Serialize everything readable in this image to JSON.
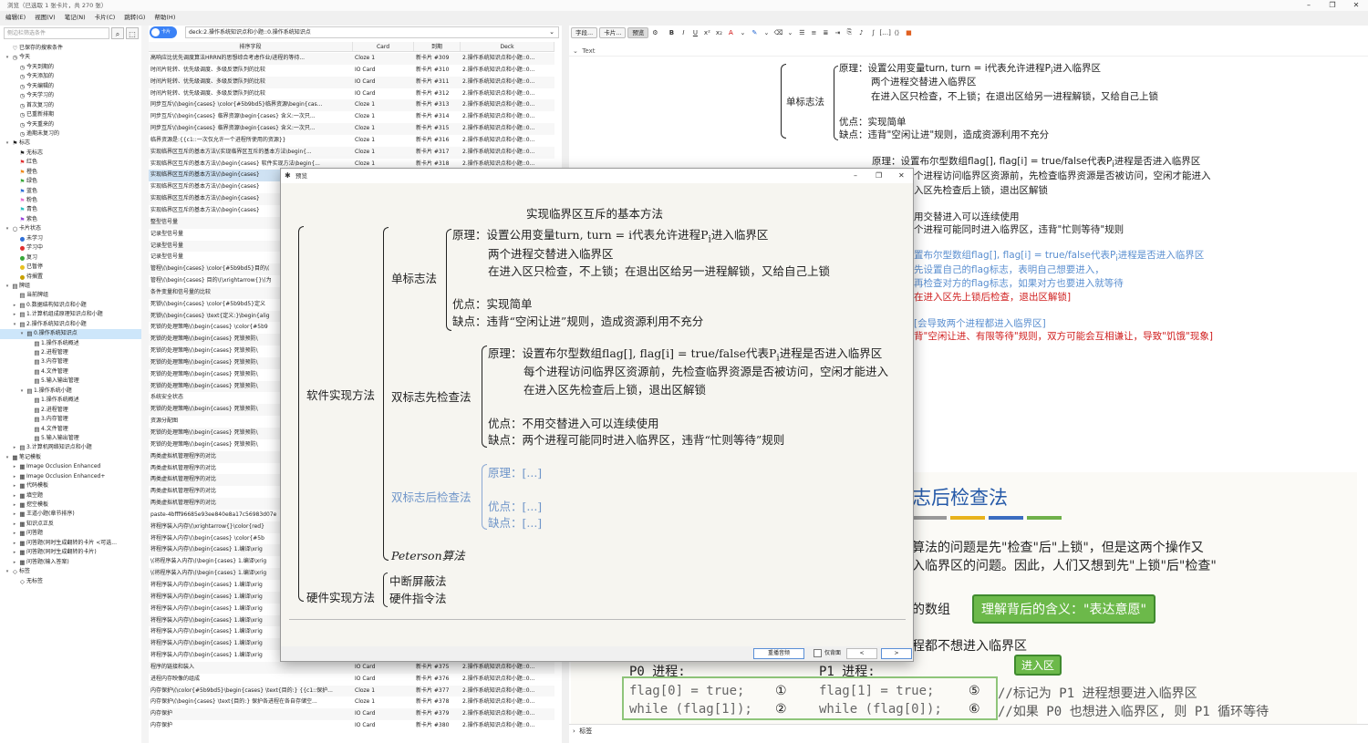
{
  "window": {
    "title": "浏览（已选取 1 张卡片，共 270 张）",
    "controls": [
      "–",
      "❐",
      "✕"
    ]
  },
  "menu": [
    "编辑(E)",
    "视图(V)",
    "笔记(N)",
    "卡片(C)",
    "跳转(G)",
    "帮助(H)"
  ],
  "sidebar": {
    "search_placeholder": "侧边栏筛选条件",
    "tree": [
      {
        "d": 0,
        "ex": "",
        "ic": "♡",
        "label": "已保存的搜索条件"
      },
      {
        "d": 0,
        "ex": "▾",
        "ic": "◷",
        "label": "今天"
      },
      {
        "d": 1,
        "ex": "",
        "ic": "◷",
        "label": "今天到期的"
      },
      {
        "d": 1,
        "ex": "",
        "ic": "◷",
        "label": "今天添加的"
      },
      {
        "d": 1,
        "ex": "",
        "ic": "◷",
        "label": "今天编辑的"
      },
      {
        "d": 1,
        "ex": "",
        "ic": "◷",
        "label": "今天学习的"
      },
      {
        "d": 1,
        "ex": "",
        "ic": "◷",
        "label": "首次复习的"
      },
      {
        "d": 1,
        "ex": "",
        "ic": "◷",
        "label": "已重新排期"
      },
      {
        "d": 1,
        "ex": "",
        "ic": "◷",
        "label": "今天重来的"
      },
      {
        "d": 1,
        "ex": "",
        "ic": "◷",
        "label": "逾期未复习的"
      },
      {
        "d": 0,
        "ex": "▾",
        "ic": "⚑",
        "label": "标志"
      },
      {
        "d": 1,
        "ex": "",
        "ic": "⚑",
        "label": "无标志"
      },
      {
        "d": 1,
        "ex": "",
        "ic": "⚑",
        "label": "红色",
        "color": "#e03030"
      },
      {
        "d": 1,
        "ex": "",
        "ic": "⚑",
        "label": "橙色",
        "color": "#f08a1c"
      },
      {
        "d": 1,
        "ex": "",
        "ic": "⚑",
        "label": "绿色",
        "color": "#38a838"
      },
      {
        "d": 1,
        "ex": "",
        "ic": "⚑",
        "label": "蓝色",
        "color": "#2f6fd8"
      },
      {
        "d": 1,
        "ex": "",
        "ic": "⚑",
        "label": "粉色",
        "color": "#e86fcf"
      },
      {
        "d": 1,
        "ex": "",
        "ic": "⚑",
        "label": "青色",
        "color": "#2ac3c3"
      },
      {
        "d": 1,
        "ex": "",
        "ic": "⚑",
        "label": "紫色",
        "color": "#9944dd"
      },
      {
        "d": 0,
        "ex": "▾",
        "ic": "○",
        "label": "卡片状态"
      },
      {
        "d": 1,
        "ex": "",
        "ic": "●",
        "label": "未学习",
        "color": "#2f6fd8"
      },
      {
        "d": 1,
        "ex": "",
        "ic": "●",
        "label": "学习中",
        "color": "#e03030"
      },
      {
        "d": 1,
        "ex": "",
        "ic": "●",
        "label": "复习",
        "color": "#38a838"
      },
      {
        "d": 1,
        "ex": "",
        "ic": "●",
        "label": "已暂停",
        "color": "#e8c020"
      },
      {
        "d": 1,
        "ex": "",
        "ic": "●",
        "label": "待搁置",
        "color": "#c8a000"
      },
      {
        "d": 0,
        "ex": "▾",
        "ic": "▤",
        "label": "牌组"
      },
      {
        "d": 1,
        "ex": "",
        "ic": "▤",
        "label": "当前牌组"
      },
      {
        "d": 1,
        "ex": "▸",
        "ic": "▤",
        "label": "0.数据结构知识点和小题"
      },
      {
        "d": 1,
        "ex": "▸",
        "ic": "▤",
        "label": "1.计算机组成原理知识点和小题"
      },
      {
        "d": 1,
        "ex": "▾",
        "ic": "▤",
        "label": "2.操作系统知识点和小题"
      },
      {
        "d": 2,
        "ex": "▾",
        "ic": "▤",
        "label": "0.操作系统知识点",
        "sel": true
      },
      {
        "d": 3,
        "ex": "",
        "ic": "▤",
        "label": "1.操作系统概述"
      },
      {
        "d": 3,
        "ex": "",
        "ic": "▤",
        "label": "2.进程管理"
      },
      {
        "d": 3,
        "ex": "",
        "ic": "▤",
        "label": "3.内存管理"
      },
      {
        "d": 3,
        "ex": "",
        "ic": "▤",
        "label": "4.文件管理"
      },
      {
        "d": 3,
        "ex": "",
        "ic": "▤",
        "label": "5.输入输出管理"
      },
      {
        "d": 2,
        "ex": "▾",
        "ic": "▤",
        "label": "1.操作系统小题"
      },
      {
        "d": 3,
        "ex": "",
        "ic": "▤",
        "label": "1.操作系统概述"
      },
      {
        "d": 3,
        "ex": "",
        "ic": "▤",
        "label": "2.进程管理"
      },
      {
        "d": 3,
        "ex": "",
        "ic": "▤",
        "label": "3.内存管理"
      },
      {
        "d": 3,
        "ex": "",
        "ic": "▤",
        "label": "4.文件管理"
      },
      {
        "d": 3,
        "ex": "",
        "ic": "▤",
        "label": "5.输入输出管理"
      },
      {
        "d": 1,
        "ex": "▸",
        "ic": "▤",
        "label": "3.计算机网络知识点和小题"
      },
      {
        "d": 0,
        "ex": "▾",
        "ic": "▦",
        "label": "笔记模板"
      },
      {
        "d": 1,
        "ex": "▸",
        "ic": "▦",
        "label": "Image Occlusion Enhanced"
      },
      {
        "d": 1,
        "ex": "▸",
        "ic": "▦",
        "label": "Image Occlusion Enhanced+"
      },
      {
        "d": 1,
        "ex": "▸",
        "ic": "▦",
        "label": "代码模板"
      },
      {
        "d": 1,
        "ex": "▸",
        "ic": "▦",
        "label": "填空题"
      },
      {
        "d": 1,
        "ex": "▸",
        "ic": "▦",
        "label": "挖空模板"
      },
      {
        "d": 1,
        "ex": "▸",
        "ic": "▦",
        "label": "王道小题(章节排序)"
      },
      {
        "d": 1,
        "ex": "▸",
        "ic": "▦",
        "label": "知识点正反"
      },
      {
        "d": 1,
        "ex": "▸",
        "ic": "▦",
        "label": "问答题"
      },
      {
        "d": 1,
        "ex": "▸",
        "ic": "▦",
        "label": "问答题(同时生成翻转的卡片 <可选..."
      },
      {
        "d": 1,
        "ex": "▸",
        "ic": "▦",
        "label": "问答题(同时生成翻转的卡片)"
      },
      {
        "d": 1,
        "ex": "▸",
        "ic": "▦",
        "label": "问答题(输入答案)"
      },
      {
        "d": 0,
        "ex": "▾",
        "ic": "◇",
        "label": "标签"
      },
      {
        "d": 1,
        "ex": "",
        "ic": "◇",
        "label": "无标签"
      }
    ]
  },
  "browser": {
    "toggle_label": "卡片",
    "query": "deck:2.操作系统知识点和小题::0.操作系统知识点",
    "columns": [
      "排序字段",
      "Card",
      "到期",
      "Deck"
    ],
    "rows": [
      [
        "高响应比优先调度算法HRRN的思想综合考虑作业/进程的等待...",
        "Cloze 1",
        "新卡片 #309",
        "2.操作系统知识点和小题::0..."
      ],
      [
        "时间片轮转、优先级调度、多级反馈队列的比较",
        "IO Card",
        "新卡片 #310",
        "2.操作系统知识点和小题::0..."
      ],
      [
        "时间片轮转、优先级调度、多级反馈队列的比较",
        "IO Card",
        "新卡片 #311",
        "2.操作系统知识点和小题::0..."
      ],
      [
        "时间片轮转、优先级调度、多级反馈队列的比较",
        "IO Card",
        "新卡片 #312",
        "2.操作系统知识点和小题::0..."
      ],
      [
        "同步互斥\\(\\begin{cases} \\color{#5b9bd5}临界资源\\begin{cas...",
        "Cloze 1",
        "新卡片 #313",
        "2.操作系统知识点和小题::0..."
      ],
      [
        "同步互斥\\(\\begin{cases} 临界资源\\begin{cases} 含义:一次只...",
        "Cloze 1",
        "新卡片 #314",
        "2.操作系统知识点和小题::0..."
      ],
      [
        "同步互斥\\(\\begin{cases} 临界资源\\begin{cases} 含义:一次只...",
        "Cloze 1",
        "新卡片 #315",
        "2.操作系统知识点和小题::0..."
      ],
      [
        "临界资源是:{{c1::一次仅允许一个进程所使用的资源}}",
        "Cloze 1",
        "新卡片 #316",
        "2.操作系统知识点和小题::0..."
      ],
      [
        "实现临界区互斥的基本方法\\(实现临界区互斥的基本方法\\begin{...",
        "Cloze 1",
        "新卡片 #317",
        "2.操作系统知识点和小题::0..."
      ],
      [
        "实现临界区互斥的基本方法\\(\\begin{cases} 软件实现方法\\begin{...",
        "Cloze 1",
        "新卡片 #318",
        "2.操作系统知识点和小题::0..."
      ],
      [
        "实现临界区互斥的基本方法\\(\\begin{cases}",
        "",
        "",
        "",
        "sel"
      ],
      [
        "实现临界区互斥的基本方法\\(\\begin{cases}",
        "",
        "",
        ""
      ],
      [
        "实现临界区互斥的基本方法\\(\\begin{cases}",
        "",
        "",
        ""
      ],
      [
        "实现临界区互斥的基本方法\\(\\begin{cases}",
        "",
        "",
        ""
      ],
      [
        "整型信号量",
        "",
        "",
        ""
      ],
      [
        "记录型信号量",
        "",
        "",
        ""
      ],
      [
        "记录型信号量",
        "",
        "",
        ""
      ],
      [
        "记录型信号量",
        "",
        "",
        ""
      ],
      [
        "管程\\(\\begin{cases} \\color{#5b9bd5}目的\\(",
        "",
        "",
        ""
      ],
      [
        "管程\\(\\begin{cases} 目的\\(\\xrightarrow{}\\(为",
        "",
        "",
        ""
      ],
      [
        "条件变量和信号量的比较",
        "",
        "",
        ""
      ],
      [
        "死锁\\(\\begin{cases} \\color{#5b9bd5}定义",
        "",
        "",
        ""
      ],
      [
        "死锁\\(\\begin{cases} \\text{定义:}\\begin{alig",
        "",
        "",
        ""
      ],
      [
        "死锁的处理策略\\(\\begin{cases} \\color{#5b9",
        "",
        "",
        ""
      ],
      [
        "死锁的处理策略\\(\\begin{cases} 死锁预防\\",
        "",
        "",
        ""
      ],
      [
        "死锁的处理策略\\(\\begin{cases} 死锁预防\\",
        "",
        "",
        ""
      ],
      [
        "死锁的处理策略\\(\\begin{cases} 死锁预防\\",
        "",
        "",
        ""
      ],
      [
        "死锁的处理策略\\(\\begin{cases} 死锁预防\\",
        "",
        "",
        ""
      ],
      [
        "死锁的处理策略\\(\\begin{cases} 死锁预防\\",
        "",
        "",
        ""
      ],
      [
        "系统安全状态",
        "",
        "",
        ""
      ],
      [
        "死锁的处理策略\\(\\begin{cases} 死锁预防\\",
        "",
        "",
        ""
      ],
      [
        "资源分配图",
        "",
        "",
        ""
      ],
      [
        "死锁的处理策略\\(\\begin{cases} 死锁预防\\",
        "",
        "",
        ""
      ],
      [
        "死锁的处理策略\\(\\begin{cases} 死锁预防\\",
        "",
        "",
        ""
      ],
      [
        "两类虚拟机管理程序的对比",
        "",
        "",
        ""
      ],
      [
        "两类虚拟机管理程序的对比",
        "",
        "",
        ""
      ],
      [
        "两类虚拟机管理程序的对比",
        "",
        "",
        ""
      ],
      [
        "两类虚拟机管理程序的对比",
        "",
        "",
        ""
      ],
      [
        "两类虚拟机管理程序的对比",
        "",
        "",
        ""
      ],
      [
        "paste-4bfff96685e93ee840e8a17c56983d07e",
        "",
        "",
        ""
      ],
      [
        "将程序装入内存\\(\\xrightarrow{}\\color{red}",
        "",
        "",
        ""
      ],
      [
        "将程序装入内存\\(\\begin{cases} \\color{#5b",
        "",
        "",
        ""
      ],
      [
        "将程序装入内存\\(\\begin{cases} 1.编译\\xrig",
        "",
        "",
        ""
      ],
      [
        "\\(将程序装入内存\\(\\begin{cases} 1.编译\\xrig",
        "",
        "",
        ""
      ],
      [
        "\\(将程序装入内存\\(\\begin{cases} 1.编译\\xrig",
        "",
        "",
        ""
      ],
      [
        "将程序装入内存\\(\\begin{cases} 1.编译\\xrig",
        "",
        "",
        ""
      ],
      [
        "将程序装入内存\\(\\begin{cases} 1.编译\\xrig",
        "",
        "",
        ""
      ],
      [
        "将程序装入内存\\(\\begin{cases} 1.编译\\xrig",
        "",
        "",
        ""
      ],
      [
        "将程序装入内存\\(\\begin{cases} 1.编译\\xrig",
        "",
        "",
        ""
      ],
      [
        "将程序装入内存\\(\\begin{cases} 1.编译\\xrig",
        "",
        "",
        ""
      ],
      [
        "将程序装入内存\\(\\begin{cases} 1.编译\\xrig",
        "",
        "",
        ""
      ],
      [
        "将程序装入内存\\(\\begin{cases} 1.编译\\xrig",
        "",
        "",
        ""
      ],
      [
        "程序的链接和装入",
        "IO Card",
        "新卡片 #375",
        "2.操作系统知识点和小题::0..."
      ],
      [
        "进程内存映像的组成",
        "IO Card",
        "新卡片 #376",
        "2.操作系统知识点和小题::0..."
      ],
      [
        "内存保护\\(\\color{#5b9bd5}\\begin{cases} \\text{目的:} {{c1::保护...",
        "Cloze 1",
        "新卡片 #377",
        "2.操作系统知识点和小题::0..."
      ],
      [
        "内存保护\\(\\begin{cases} \\text{目的:} 保护各进程在各自存储空...",
        "Cloze 1",
        "新卡片 #378",
        "2.操作系统知识点和小题::0..."
      ],
      [
        "内存保护",
        "IO Card",
        "新卡片 #379",
        "2.操作系统知识点和小题::0..."
      ],
      [
        "内存保护",
        "IO Card",
        "新卡片 #380",
        "2.操作系统知识点和小题::0..."
      ]
    ]
  },
  "editor": {
    "toolbar": {
      "fields_btn": "字段...",
      "cards_btn": "卡片...",
      "preview_btn": "预览"
    },
    "field_name": "Text",
    "status_tags": "标签",
    "bg_text": {
      "single_flag": "单标志法",
      "principle_1": "原理：设置公用变量turn, turn = i代表允许进程P",
      "principle_1_sub": "i",
      "principle_1_end": "进入临界区",
      "line2": "两个进程交替进入临界区",
      "line3": "在进入区只检查，不上锁；在退出区给另一进程解锁，又给自己上锁",
      "pro": "优点：实现简单",
      "con": "缺点：违背\"空闲让进\"规则，造成资源利用不充分",
      "dbl_p1": "原理：设置布尔型数组flag[], flag[i] = true/false代表P",
      "dbl_p1_end": "进程是否进入临界区",
      "dbl_l2": "个进程访问临界区资源前，先检查临界资源是否被访问，空闲才能进入",
      "dbl_l3": "入区先检查后上锁，退出区解锁",
      "dbl_pro": "用交替进入可以连续使用",
      "dbl_con": "个进程可能同时进入临界区，违背\"忙则等待\"规则",
      "after_p1": "置布尔型数组flag[], flag[i] = true/false代表P",
      "after_p1_end": "进程是否进入临界区",
      "after_l2": "先设置自己的flag标志，表明自己想要进入，",
      "after_l3": "再检查对方的flag标志，如果对方也要进入就等待",
      "after_l4": "在进入区先上锁后检查，退出区解锁]",
      "after_pro": "[会导致两个进程都进入临界区]",
      "after_con": "背\"空闲让进、有限等待\"规则，双方可能会互相谦让，导致\"饥饿\"现象]"
    },
    "pdf": {
      "heading": "志后检查法",
      "para1": "算法的问题是先\"检查\"后\"上锁\"，但是这两个操作又",
      "para2": "入临界区的问题。因此，人们又想到先\"上锁\"后\"检查\"",
      "array_text": "的数组",
      "callout1": "理解背后的含义：\"表达意愿\"",
      "nobody": "程都不想进入临界区",
      "p0": "P0 进程:",
      "p1": "P1 进程:",
      "callout2": "进入区",
      "code_p0_1": "flag[0] = true;",
      "code_p0_2": "while (flag[1]);",
      "code_n1": "①",
      "code_n2": "②",
      "code_p1_1": "flag[1] = true;",
      "code_p1_2": "while (flag[0]);",
      "code_n5": "⑤",
      "code_n6": "⑥",
      "comment1": "//标记为 P1 进程想要进入临界区",
      "comment2": "//如果 P0 也想进入临界区, 则 P1 循环等待",
      "bar_colors": [
        "#999999",
        "#e8b21c",
        "#3a6cc0",
        "#6fb04a"
      ]
    }
  },
  "preview": {
    "title": "预览",
    "heading": "实现临界区互斥的基本方法",
    "software": "软件实现方法",
    "hardware": "硬件实现方法",
    "single": "单标志法",
    "s_p1a": "原理：设置公用变量turn, turn = i代表允许进程P",
    "s_p1b": "进入临界区",
    "s_sub": "i",
    "s_l2": "两个进程交替进入临界区",
    "s_l3": "在进入区只检查，不上锁；在退出区给另一进程解锁，又给自己上锁",
    "s_pro": "优点：实现简单",
    "s_con": "缺点：违背“空闲让进”规则，造成资源利用不充分",
    "double_first": "双标志先检查法",
    "d_p1a": "原理：设置布尔型数组flag[], flag[i] = true/false代表P",
    "d_p1b": "进程是否进入临界区",
    "d_l2": "每个进程访问临界区资源前，先检查临界资源是否被访问，空闲才能进入",
    "d_l3": "在进入区先检查后上锁，退出区解锁",
    "d_pro": "优点：不用交替进入可以连续使用",
    "d_con": "缺点：两个进程可能同时进入临界区，违背“忙则等待”规则",
    "double_after": "双标志后检查法",
    "a_p": "原理：[...]",
    "a_pro": "优点：[...]",
    "a_con": "缺点：[...]",
    "peterson": "Peterson算法",
    "hw1": "中断屏蔽法",
    "hw2": "硬件指令法",
    "btn_replay": "重播音频",
    "chk_back": "仅背面",
    "btn_prev": "<",
    "btn_next": ">"
  }
}
